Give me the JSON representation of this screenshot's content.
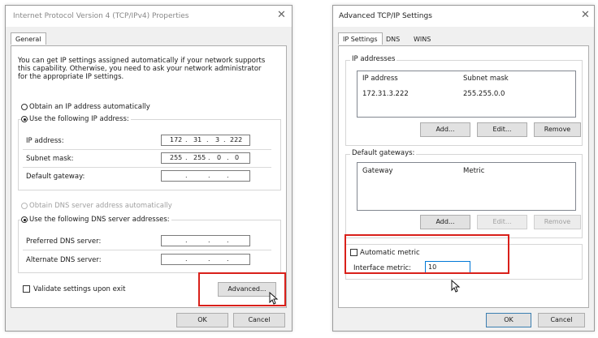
{
  "left_dialog": {
    "title": "Internet Protocol Version 4 (TCP/IPv4) Properties",
    "close_glyph": "✕",
    "tab_general": "General",
    "description": [
      "You can get IP settings assigned automatically if your network supports",
      "this capability. Otherwise, you need to ask your network administrator",
      "for the appropriate IP settings."
    ],
    "radio_obtain_ip": "Obtain an IP address automatically",
    "radio_use_ip": "Use the following IP address:",
    "ip_address_label": "IP address:",
    "ip_address_value": [
      "172",
      "31",
      "3",
      "222"
    ],
    "subnet_mask_label": "Subnet mask:",
    "subnet_mask_value": [
      "255",
      "255",
      "0",
      "0"
    ],
    "default_gateway_label": "Default gateway:",
    "radio_obtain_dns": "Obtain DNS server address automatically",
    "radio_use_dns": "Use the following DNS server addresses:",
    "preferred_dns_label": "Preferred DNS server:",
    "alternate_dns_label": "Alternate DNS server:",
    "validate_label": "Validate settings upon exit",
    "advanced_button": "Advanced...",
    "ok_button": "OK",
    "cancel_button": "Cancel",
    "dot": "."
  },
  "right_dialog": {
    "title": "Advanced TCP/IP Settings",
    "close_glyph": "✕",
    "tabs": [
      "IP Settings",
      "DNS",
      "WINS"
    ],
    "ip_addresses_group": "IP addresses",
    "col_ip": "IP address",
    "col_subnet": "Subnet mask",
    "row_ip": "172.31.3.222",
    "row_subnet": "255.255.0.0",
    "add_button": "Add...",
    "edit_button": "Edit...",
    "remove_button": "Remove",
    "gateways_group": "Default gateways:",
    "col_gateway": "Gateway",
    "col_metric": "Metric",
    "automatic_metric_label": "Automatic metric",
    "interface_metric_label": "Interface metric:",
    "interface_metric_value": "10",
    "ok_button": "OK",
    "cancel_button": "Cancel"
  },
  "colors": {
    "highlight": "#d9201a",
    "dialog_bg": "#f0f0f0",
    "accent": "#0078d7"
  }
}
